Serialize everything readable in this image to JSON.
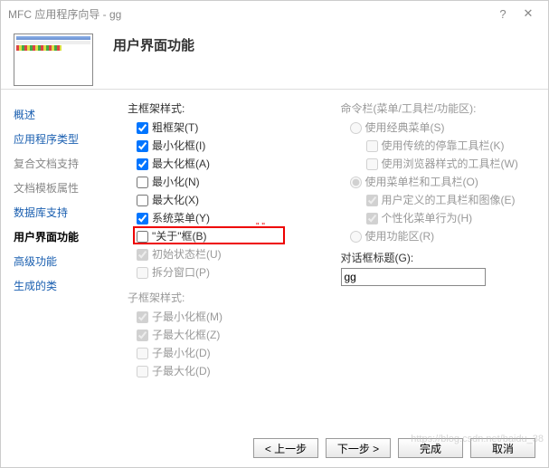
{
  "titlebar": {
    "text": "MFC 应用程序向导 - gg",
    "help": "?",
    "close": "✕"
  },
  "header": {
    "title": "用户界面功能"
  },
  "sidebar": {
    "items": [
      {
        "label": "概述",
        "link": true
      },
      {
        "label": "应用程序类型",
        "link": true
      },
      {
        "label": "复合文档支持",
        "link": false
      },
      {
        "label": "文档模板属性",
        "link": false
      },
      {
        "label": "数据库支持",
        "link": true
      },
      {
        "label": "用户界面功能",
        "current": true
      },
      {
        "label": "高级功能",
        "link": true
      },
      {
        "label": "生成的类",
        "link": true
      }
    ]
  },
  "mainframe": {
    "group": "主框架样式:",
    "opts": [
      {
        "label": "粗框架(T)",
        "checked": true
      },
      {
        "label": "最小化框(I)",
        "checked": true
      },
      {
        "label": "最大化框(A)",
        "checked": true
      },
      {
        "label": "最小化(N)",
        "checked": false
      },
      {
        "label": "最大化(X)",
        "checked": false
      },
      {
        "label": "系统菜单(Y)",
        "checked": true
      },
      {
        "label": "\"关于\"框(B)",
        "checked": false,
        "highlight": true,
        "htext": "\" \""
      },
      {
        "label": "初始状态栏(U)",
        "checked": true,
        "disabled": true
      },
      {
        "label": "拆分窗口(P)",
        "checked": false,
        "disabled": true
      }
    ]
  },
  "childframe": {
    "group": "子框架样式:",
    "opts": [
      {
        "label": "子最小化框(M)",
        "checked": true,
        "disabled": true
      },
      {
        "label": "子最大化框(Z)",
        "checked": true,
        "disabled": true
      },
      {
        "label": "子最小化(D)",
        "checked": false,
        "disabled": true
      },
      {
        "label": "子最大化(D)",
        "checked": false,
        "disabled": true
      }
    ]
  },
  "cmdbar": {
    "group": "命令栏(菜单/工具栏/功能区):",
    "r_classic": "使用经典菜单(S)",
    "c_trad": "使用传统的停靠工具栏(K)",
    "c_browser": "使用浏览器样式的工具栏(W)",
    "r_menubar": "使用菜单栏和工具栏(O)",
    "c_userdef": "用户定义的工具栏和图像(E)",
    "c_personal": "个性化菜单行为(H)",
    "r_ribbon": "使用功能区(R)"
  },
  "dlgtitle": {
    "label": "对话框标题(G):",
    "value": "gg"
  },
  "footer": {
    "prev": "< 上一步",
    "next": "下一步 >",
    "finish": "完成",
    "cancel": "取消"
  },
  "watermark": "https://blog.csdn.net/baidu_38"
}
